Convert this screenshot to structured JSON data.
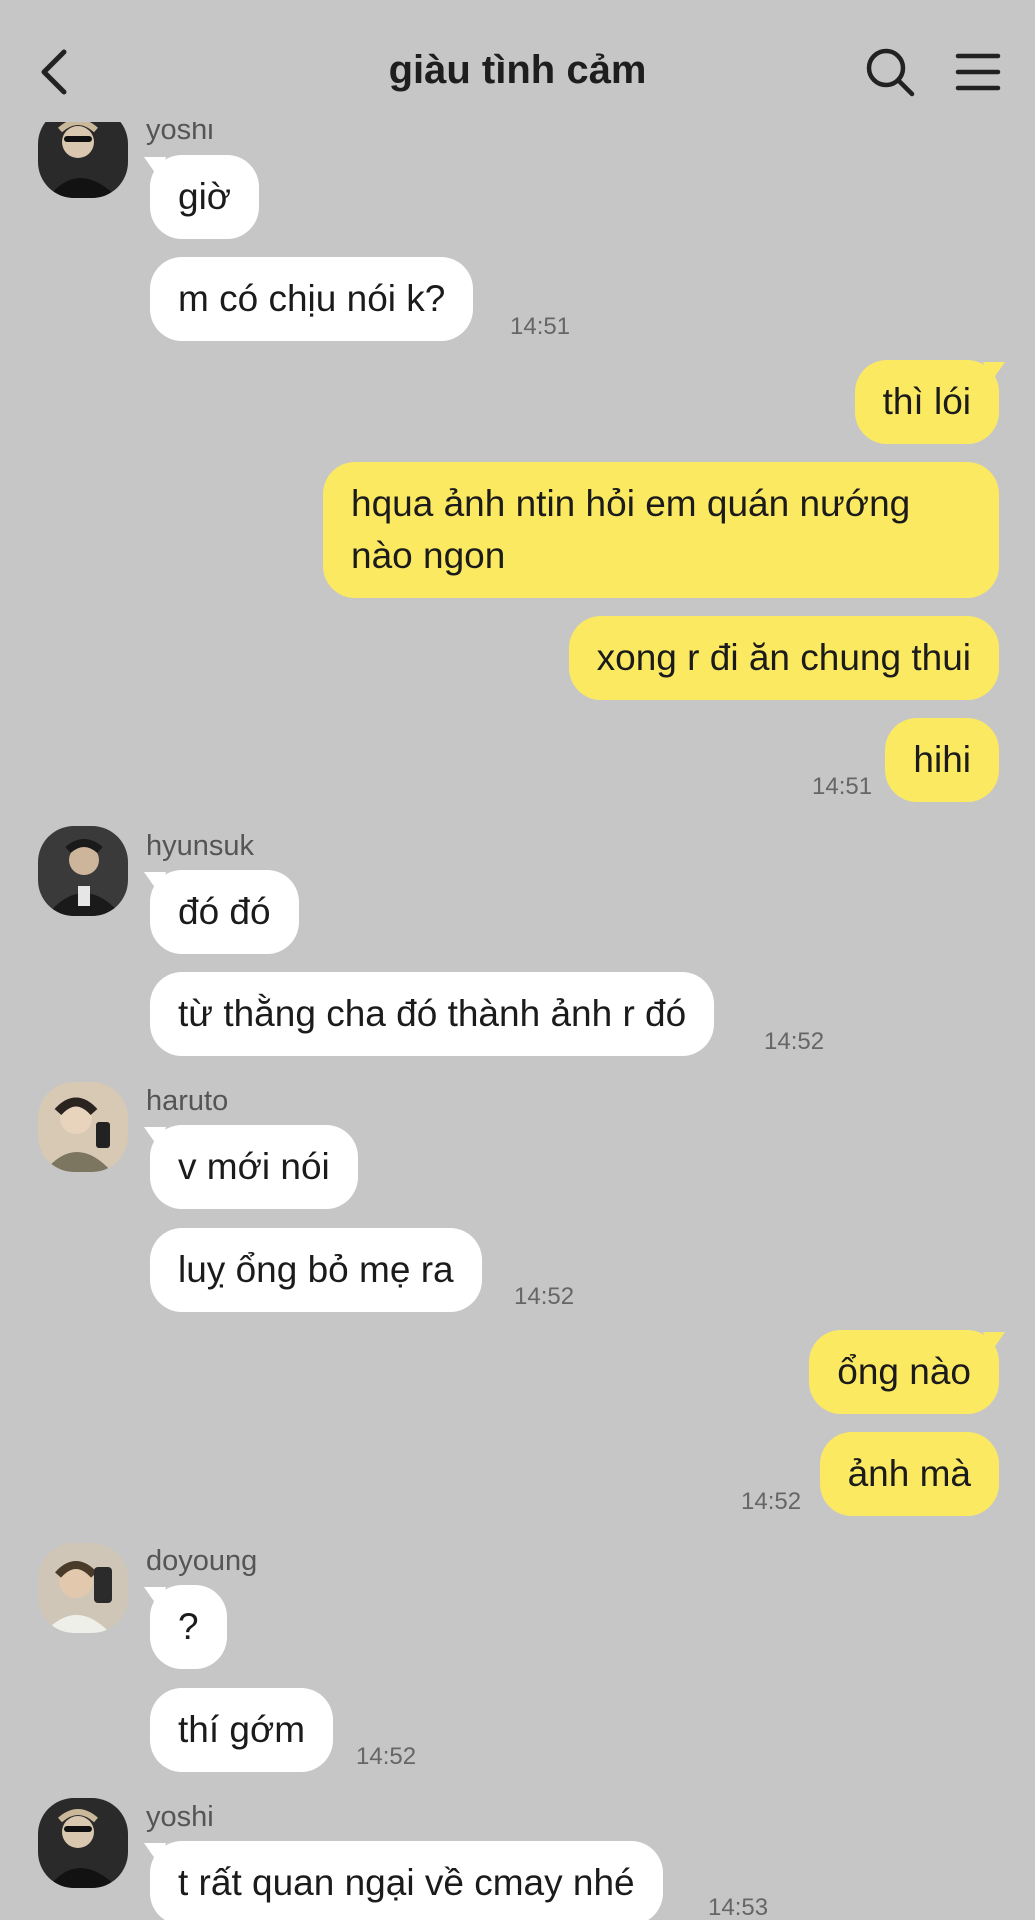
{
  "header": {
    "title": "giàu tình cảm"
  },
  "messages": {
    "g1": {
      "sender": "yoshi",
      "m1": "giờ",
      "m2": "m có chịu nói k?",
      "time": "14:51"
    },
    "me1": {
      "m1": "thì lói",
      "m2": "hqua ảnh ntin hỏi em quán nướng nào ngon",
      "m3": "xong r đi ăn chung thui",
      "m4": "hihi",
      "time": "14:51"
    },
    "g2": {
      "sender": "hyunsuk",
      "m1": "đó đó",
      "m2": "từ thằng cha đó thành ảnh r đó",
      "time": "14:52"
    },
    "g3": {
      "sender": "haruto",
      "m1": "v mới nói",
      "m2": "luỵ ổng bỏ mẹ ra",
      "time": "14:52"
    },
    "me2": {
      "m1": "ổng nào",
      "m2": "ảnh mà",
      "time": "14:52"
    },
    "g4": {
      "sender": "doyoung",
      "m1": "?",
      "m2": "thí gớm",
      "time": "14:52"
    },
    "g5": {
      "sender": "yoshi",
      "m1": "t rất quan ngại về cmay nhé",
      "time": "14:53"
    }
  },
  "colors": {
    "background": "#c6c6c6",
    "outgoing_bubble": "#fbe962",
    "incoming_bubble": "#ffffff"
  },
  "icons": [
    "back-arrow-icon",
    "search-icon",
    "menu-icon"
  ]
}
